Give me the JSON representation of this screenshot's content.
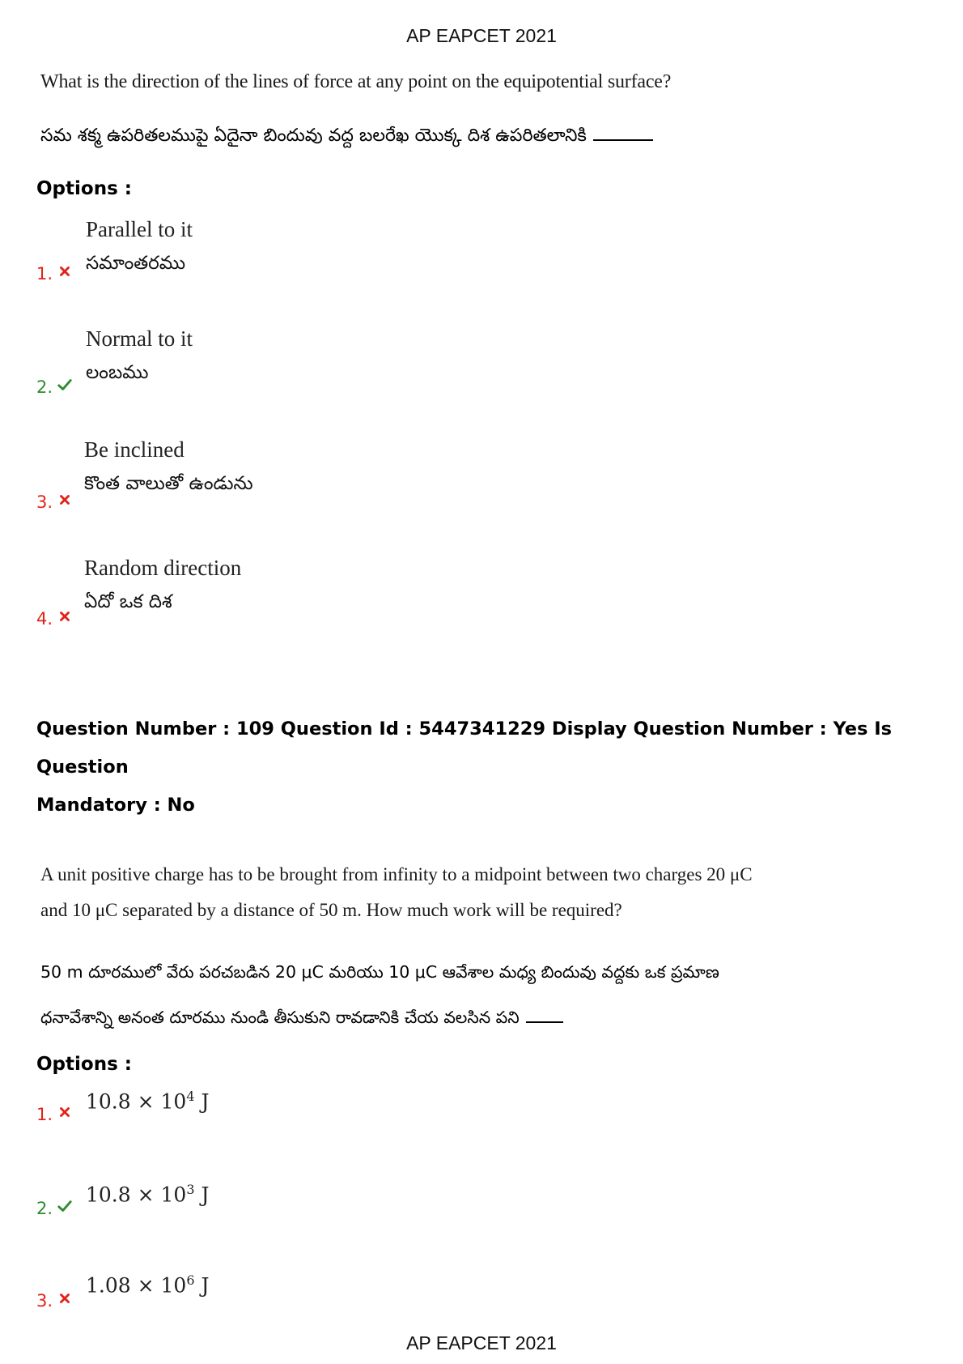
{
  "header": {
    "title": "AP EAPCET 2021"
  },
  "footer": {
    "title": "AP EAPCET 2021"
  },
  "q1": {
    "text_en": "What is the direction of the lines of force at any point on the equipotential surface?",
    "text_te": "సమ శక్మ ఉపరితలముపై ఏదైనా బిందువు వద్ద బలరేఖ యొక్క దిశ ఉపరితలానికి",
    "options_label": "Options :",
    "options": [
      {
        "num": "1.",
        "en": "Parallel to it",
        "te": "సమాంతరము",
        "correct": false
      },
      {
        "num": "2.",
        "en": "Normal to it",
        "te": "లంబము",
        "correct": true
      },
      {
        "num": "3.",
        "en": "Be inclined",
        "te": "కొంత వాలుతో ఉండును",
        "correct": false
      },
      {
        "num": "4.",
        "en": "Random direction",
        "te": "ఏదో ఒక దిశ",
        "correct": false
      }
    ]
  },
  "q2": {
    "meta_line1": "Question Number : 109 Question Id : 5447341229 Display Question Number : Yes Is Question",
    "meta_line2": "Mandatory : No",
    "text_en_1": "A unit positive charge has to be brought from infinity to a midpoint between two charges 20 μC",
    "text_en_2": "and 10 μC separated by a distance of 50 m. How much work will be required?",
    "text_te_1": "50 m దూరములో వేరు పరచబడిన 20 μC మరియు 10 μC ఆవేశాల మధ్య బిందువు వద్దకు ఒక ప్రమాణ",
    "text_te_2": "ధనావేశాన్ని అనంత దూరము నుండి తీసుకుని రావడానికి చేయ వలసిన పని",
    "options_label": "Options :",
    "options": [
      {
        "num": "1.",
        "mantissa": "10.8 × 10",
        "exp": "4",
        "unit": " J",
        "correct": false
      },
      {
        "num": "2.",
        "mantissa": "10.8 × 10",
        "exp": "3",
        "unit": " J",
        "correct": true
      },
      {
        "num": "3.",
        "mantissa": "1.08 × 10",
        "exp": "6",
        "unit": " J",
        "correct": false
      }
    ]
  },
  "colors": {
    "wrong": "#e2231a",
    "correct": "#2e8b2e"
  }
}
